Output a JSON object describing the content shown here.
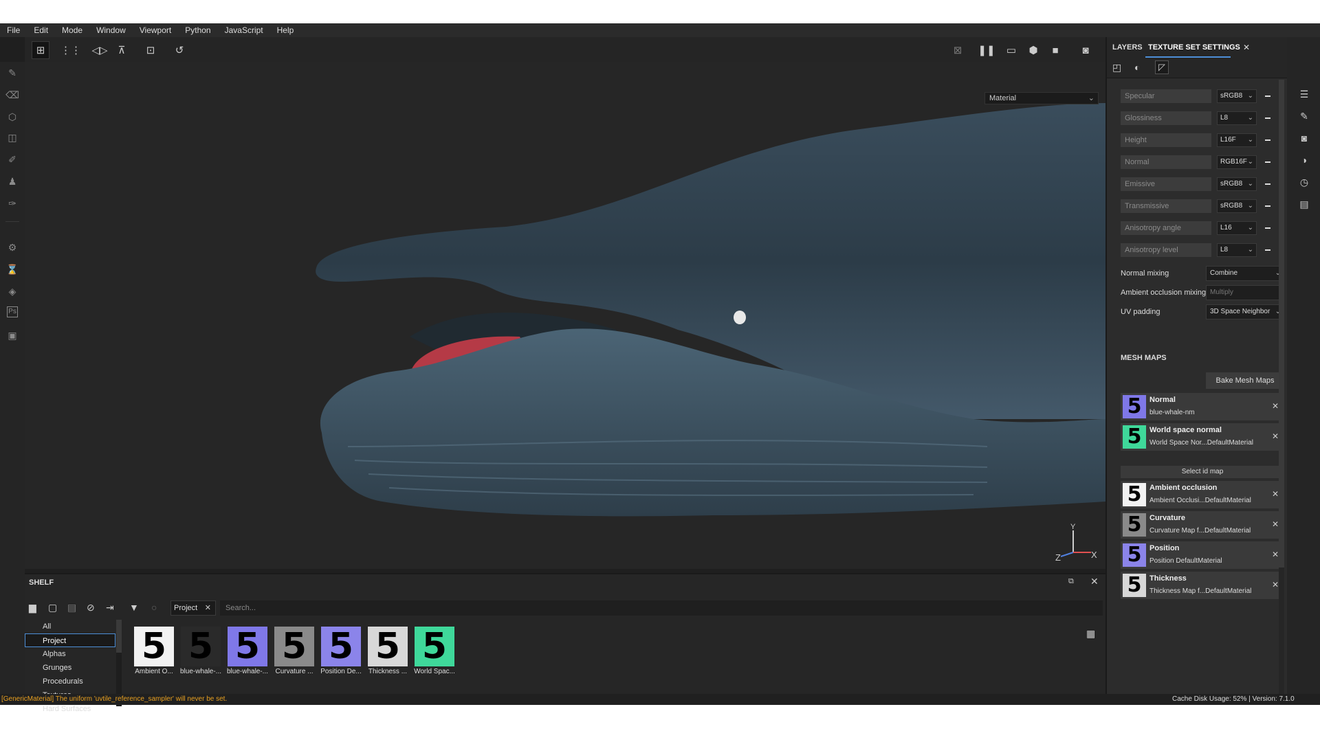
{
  "menubar": [
    "File",
    "Edit",
    "Mode",
    "Window",
    "Viewport",
    "Python",
    "JavaScript",
    "Help"
  ],
  "viewport": {
    "display_select": "Material"
  },
  "axis": {
    "x": "X",
    "y": "Y",
    "z": "Z"
  },
  "shelf": {
    "title": "SHELF",
    "tab": "Project",
    "search_placeholder": "Search...",
    "categories": [
      "All",
      "Project",
      "Alphas",
      "Grunges",
      "Procedurals",
      "Textures",
      "Hard Surfaces"
    ],
    "selected_category": "Project",
    "thumbnails": [
      {
        "label": "Ambient O...",
        "glyph": "5",
        "bg": "#f2f2f2"
      },
      {
        "label": "blue-whale-...",
        "glyph": "5",
        "bg": "#2a2a2a"
      },
      {
        "label": "blue-whale-...",
        "glyph": "5",
        "bg": "#7f78e8"
      },
      {
        "label": "Curvature ...",
        "glyph": "5",
        "bg": "#8a8a8a"
      },
      {
        "label": "Position De...",
        "glyph": "5",
        "bg": "#8b84ea"
      },
      {
        "label": "Thickness ...",
        "glyph": "5",
        "bg": "#d8d8d8"
      },
      {
        "label": "World Spac...",
        "glyph": "5",
        "bg": "#3fd89a"
      }
    ]
  },
  "right_panel": {
    "tabs": [
      "LAYERS",
      "TEXTURE SET SETTINGS"
    ],
    "active_tab": "TEXTURE SET SETTINGS",
    "channels": [
      {
        "name": "Specular",
        "format": "sRGB8"
      },
      {
        "name": "Glossiness",
        "format": "L8"
      },
      {
        "name": "Height",
        "format": "L16F"
      },
      {
        "name": "Normal",
        "format": "RGB16F"
      },
      {
        "name": "Emissive",
        "format": "sRGB8"
      },
      {
        "name": "Transmissive",
        "format": "sRGB8"
      },
      {
        "name": "Anisotropy angle",
        "format": "L16"
      },
      {
        "name": "Anisotropy level",
        "format": "L8"
      }
    ],
    "normal_mixing": {
      "label": "Normal mixing",
      "value": "Combine"
    },
    "ao_mixing": {
      "label": "Ambient occlusion mixing",
      "value": "Multiply"
    },
    "uv_padding": {
      "label": "UV padding",
      "value": "3D Space Neighbor"
    },
    "mesh_maps_title": "MESH MAPS",
    "bake_button": "Bake Mesh Maps",
    "select_id_map": "Select id map",
    "mesh_maps": [
      {
        "title": "Normal",
        "sub": "blue-whale-nm",
        "bg": "#7f78e8"
      },
      {
        "title": "World space normal",
        "sub": "World Space Nor...DefaultMaterial",
        "bg": "#3fd89a"
      },
      {
        "title": "Ambient occlusion",
        "sub": "Ambient Occlusi...DefaultMaterial",
        "bg": "#f2f2f2"
      },
      {
        "title": "Curvature",
        "sub": "Curvature Map f...DefaultMaterial",
        "bg": "#8a8a8a"
      },
      {
        "title": "Position",
        "sub": "Position DefaultMaterial",
        "bg": "#8b84ea"
      },
      {
        "title": "Thickness",
        "sub": "Thickness Map f...DefaultMaterial",
        "bg": "#d8d8d8"
      }
    ]
  },
  "status": {
    "message": "[GenericMaterial] The uniform 'uvtile_reference_sampler' will never be set.",
    "cache": "Cache Disk Usage:    52% | Version: 7.1.0"
  }
}
